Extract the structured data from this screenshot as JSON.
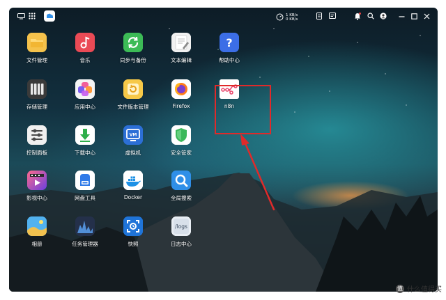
{
  "colors": {
    "highlight": "#e02a2a",
    "sky_top": "#0d1c26",
    "sky_glow": "#28969f",
    "label_text": "#ffffff"
  },
  "topbar": {
    "speed_up": "1 KB/s",
    "speed_down": "0 KB/s",
    "icons": [
      "show-desktop-icon",
      "app-grid-icon",
      "file-app-icon",
      "speed-gauge-icon",
      "storage-icon",
      "task-icon",
      "notification-icon",
      "search-icon",
      "user-icon",
      "minimize-icon",
      "maximize-icon",
      "close-icon"
    ]
  },
  "apps": [
    {
      "label": "文件管理",
      "icon": "folder-icon",
      "color": "#f2c14e"
    },
    {
      "label": "音乐",
      "icon": "music-icon",
      "color": "#e8454c"
    },
    {
      "label": "同步与备份",
      "icon": "sync-icon",
      "color": "#3cba54"
    },
    {
      "label": "文本编辑",
      "icon": "notepad-icon",
      "color": "#f2f2f2"
    },
    {
      "label": "帮助中心",
      "icon": "help-icon",
      "color": "#3a6fe0"
    },
    {
      "label": "存储管理",
      "icon": "storage-icon",
      "color": "#3b3b3b"
    },
    {
      "label": "应用中心",
      "icon": "app-center-icon",
      "color": "#f2f2f2"
    },
    {
      "label": "文件版本管理",
      "icon": "version-icon",
      "color": "#f6c846"
    },
    {
      "label": "Firefox",
      "icon": "firefox-icon",
      "color": "#ffffff"
    },
    {
      "label": "n8n",
      "icon": "n8n-icon",
      "color": "#ffffff"
    },
    {
      "label": "控制面板",
      "icon": "control-panel-icon",
      "color": "#f2f2f2"
    },
    {
      "label": "下载中心",
      "icon": "download-icon",
      "color": "#ffffff"
    },
    {
      "label": "虚拟机",
      "icon": "vm-icon",
      "color": "#2c6fd6"
    },
    {
      "label": "安全管家",
      "icon": "shield-icon",
      "color": "#ffffff"
    },
    {
      "label": "影视中心",
      "icon": "video-icon",
      "color": "#7a3fd0"
    },
    {
      "label": "网盘工具",
      "icon": "cloud-drive-icon",
      "color": "#ffffff"
    },
    {
      "label": "Docker",
      "icon": "docker-icon",
      "color": "#ffffff"
    },
    {
      "label": "全局搜索",
      "icon": "global-search-icon",
      "color": "#2f8fe8"
    },
    {
      "label": "相册",
      "icon": "photo-icon",
      "color": "#3aa0e8"
    },
    {
      "label": "任务管理器",
      "icon": "task-manager-icon",
      "color": "#26324a"
    },
    {
      "label": "快照",
      "icon": "snapshot-icon",
      "color": "#1f73d6"
    },
    {
      "label": "日志中心",
      "icon": "logs-icon",
      "color": "#e8edf3",
      "text": "/logs"
    }
  ],
  "watermark": {
    "logo_text": "值",
    "text": "什么值得买"
  }
}
